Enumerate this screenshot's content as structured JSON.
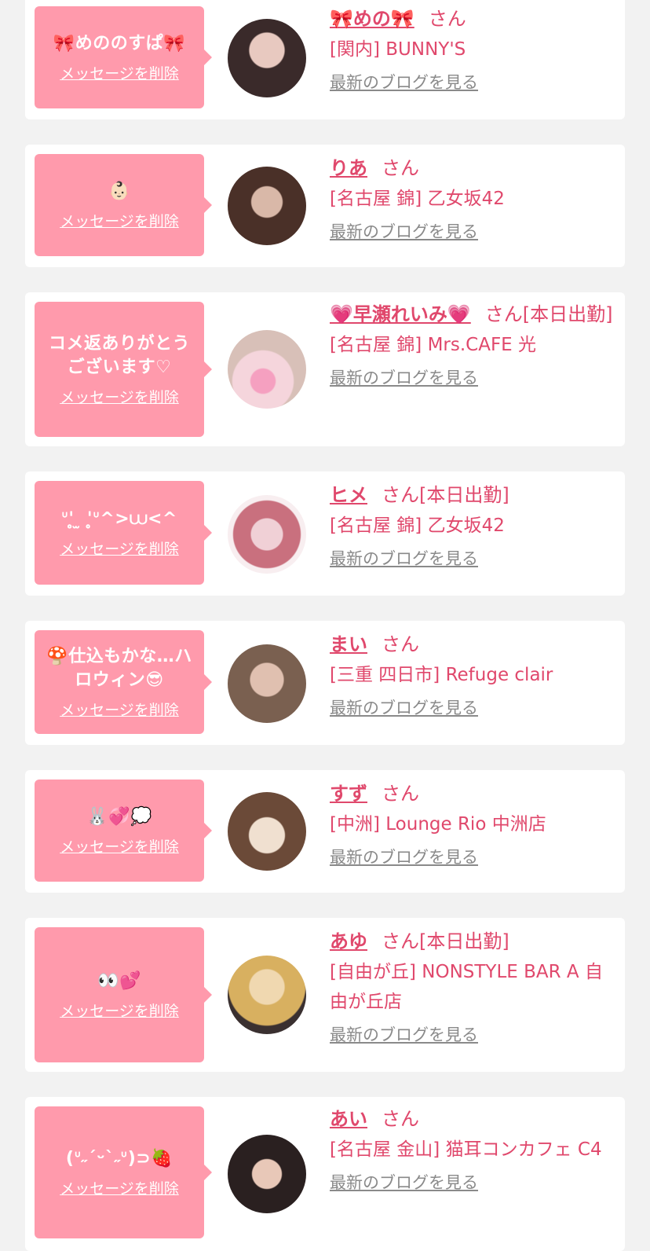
{
  "common": {
    "delete_label": "メッセージを削除",
    "san_label": "さん",
    "blog_label": "最新のブログを見る"
  },
  "items": [
    {
      "comment": "🎀めののすぱ🎀",
      "name": "🎀めの🎀",
      "status": "",
      "shop": "[関内] BUNNY'S",
      "avatar_colors": [
        "#3a2a2a",
        "#e8c9c0"
      ]
    },
    {
      "comment": "👶🏻",
      "name": "りあ",
      "status": "",
      "shop": "[名古屋 錦] 乙女坂42",
      "avatar_colors": [
        "#4a3028",
        "#d9b8a8"
      ]
    },
    {
      "comment": "コメ返ありがとうございます♡",
      "name": "💗早瀬れいみ💗",
      "status": "[本日出勤]",
      "shop": "[名古屋 錦] Mrs.CAFE 光",
      "avatar_colors": [
        "#d8c0b8",
        "#f5d5dc"
      ]
    },
    {
      "comment": "ᐡ'̥̥̥ ̫ '̥̥̥ᐡ^>⩊<^",
      "name": "ヒメ",
      "status": "[本日出勤]",
      "shop": "[名古屋 錦] 乙女坂42",
      "avatar_colors": [
        "#f0d0d6",
        "#c9707e"
      ]
    },
    {
      "comment": "🍄仕込もかな…ハロウィン😎",
      "name": "まい",
      "status": "",
      "shop": "[三重 四日市] Refuge clair",
      "avatar_colors": [
        "#7a6050",
        "#e0c0b0"
      ]
    },
    {
      "comment": "🐰💞💭",
      "name": "すず",
      "status": "",
      "shop": "[中洲] Lounge Rio 中洲店",
      "avatar_colors": [
        "#6b4a38",
        "#f0e0d0"
      ]
    },
    {
      "comment": "👀💕",
      "name": "あゆ",
      "status": "[本日出勤]",
      "shop": "[自由が丘] NONSTYLE BAR A 自由が丘店",
      "avatar_colors": [
        "#d8b060",
        "#3a3030"
      ]
    },
    {
      "comment": "(ᐡ˶ˊᵕˋ˶ᐡ)⊃🍓",
      "name": "あい",
      "status": "",
      "shop": "[名古屋 金山] 猫耳コンカフェ C4",
      "avatar_colors": [
        "#2a2020",
        "#e8c8b8"
      ]
    }
  ]
}
